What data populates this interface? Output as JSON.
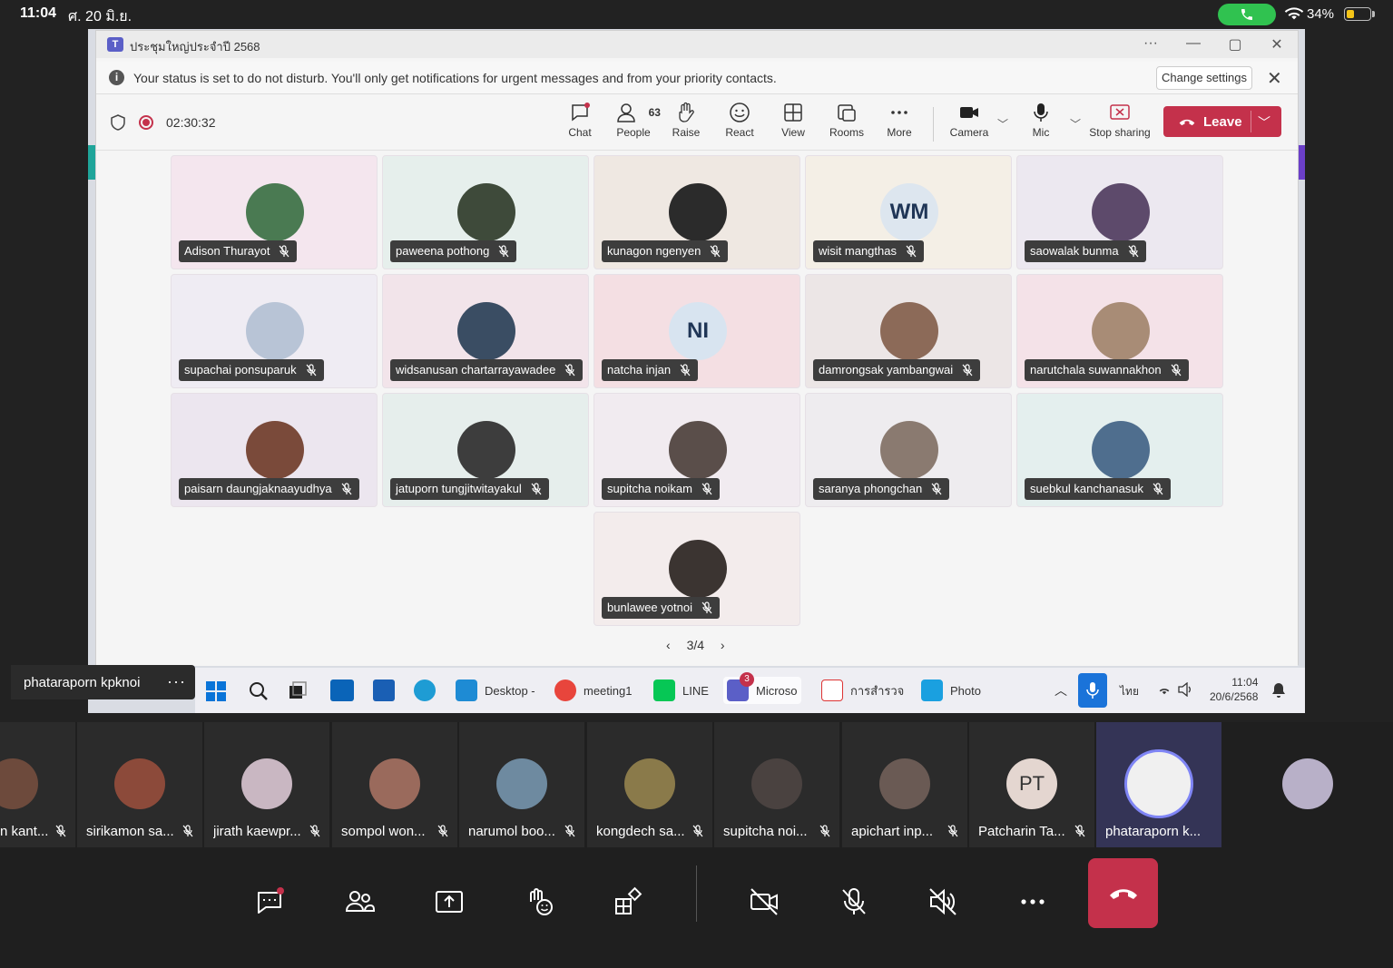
{
  "ios_status": {
    "time": "11:04",
    "date": "ศ. 20 มิ.ย.",
    "battery": "34%",
    "battery_level": 0.34
  },
  "teams_window": {
    "title": "ประชุมใหญ่ประจำปี 2568",
    "logo": "T",
    "banner_text": "Your status is set to do not disturb. You'll only get notifications for urgent messages and from your priority contacts.",
    "banner_button": "Change settings",
    "timer": "02:30:32",
    "people_count": "63",
    "toolbar": {
      "chat": "Chat",
      "people": "People",
      "raise": "Raise",
      "react": "React",
      "view": "View",
      "rooms": "Rooms",
      "more": "More",
      "camera": "Camera",
      "mic": "Mic",
      "stop_sharing": "Stop sharing",
      "leave": "Leave"
    },
    "pager": "3/4"
  },
  "tiles": [
    {
      "name": "Adison Thurayot",
      "initials": "",
      "bg": "#f4e6ee",
      "av": "#4a7a52"
    },
    {
      "name": "paweena pothong",
      "initials": "",
      "bg": "#e6efec",
      "av": "#3e4a3a"
    },
    {
      "name": "kunagon ngenyen",
      "initials": "",
      "bg": "#efe8e2",
      "av": "#2b2b2b"
    },
    {
      "name": "wisit mangthas",
      "initials": "WM",
      "bg": "#f4efe6",
      "av": "#dde6ef"
    },
    {
      "name": "saowalak bunma",
      "initials": "",
      "bg": "#ece8f0",
      "av": "#5d4a6b"
    },
    {
      "name": "supachai ponsuparuk",
      "initials": "",
      "bg": "#efecf3",
      "av": "#b8c4d6"
    },
    {
      "name": "widsanusan chartarrayawadee",
      "initials": "",
      "bg": "#f2e4ea",
      "av": "#3a4d63"
    },
    {
      "name": "natcha injan",
      "initials": "NI",
      "bg": "#f4dfe3",
      "av": "#d8e4f0"
    },
    {
      "name": "damrongsak yambangwai",
      "initials": "",
      "bg": "#ece6e6",
      "av": "#8c6a58"
    },
    {
      "name": "narutchala suwannakhon",
      "initials": "",
      "bg": "#f4e2e8",
      "av": "#a88c76"
    },
    {
      "name": "paisarn daungjaknaayudhya",
      "initials": "",
      "bg": "#ece6ef",
      "av": "#7a4a3a"
    },
    {
      "name": "jatuporn tungjitwitayakul",
      "initials": "",
      "bg": "#e6eeec",
      "av": "#3d3d3d"
    },
    {
      "name": "supitcha noikam",
      "initials": "",
      "bg": "#f1ebf0",
      "av": "#5a4e4a"
    },
    {
      "name": "saranya phongchan",
      "initials": "",
      "bg": "#eeecef",
      "av": "#8a7a70"
    },
    {
      "name": "suebkul kanchanasuk",
      "initials": "",
      "bg": "#e4efee",
      "av": "#4f6e8e"
    },
    {
      "name": "bunlawee yotnoi",
      "initials": "",
      "bg": "#f3ecec",
      "av": "#3b3431"
    }
  ],
  "taskbar": {
    "items": [
      "Desktop -",
      "meeting1",
      "LINE",
      "Microso",
      "การสำรวจ",
      "Photo"
    ],
    "teams_badge": "3",
    "lang": "ไทย",
    "time": "11:04",
    "date": "20/6/2568"
  },
  "presenter": {
    "name": "phataraporn kpknoi",
    "more": "···"
  },
  "participants": [
    {
      "name": "n kant...",
      "initials": "",
      "av": "#6d4a3c"
    },
    {
      "name": "sirikamon sa...",
      "initials": "",
      "av": "#8c4a3a"
    },
    {
      "name": "jirath kaewpr...",
      "initials": "",
      "av": "#c9b7c2"
    },
    {
      "name": "sompol won...",
      "initials": "",
      "av": "#9a6a5c"
    },
    {
      "name": "narumol boo...",
      "initials": "",
      "av": "#6e8aa0"
    },
    {
      "name": "kongdech sa...",
      "initials": "",
      "av": "#8a7a4a"
    },
    {
      "name": "supitcha noi...",
      "initials": "",
      "av": "#4a4240"
    },
    {
      "name": "apichart inp...",
      "initials": "",
      "av": "#6a5a54"
    },
    {
      "name": "Patcharin Ta...",
      "initials": "PT",
      "av": "#e4d6d0"
    },
    {
      "name": "phataraporn k...",
      "initials": "",
      "av": "#f0f0f0"
    },
    {
      "name": "",
      "initials": "",
      "av": "#b8b0c8"
    }
  ]
}
